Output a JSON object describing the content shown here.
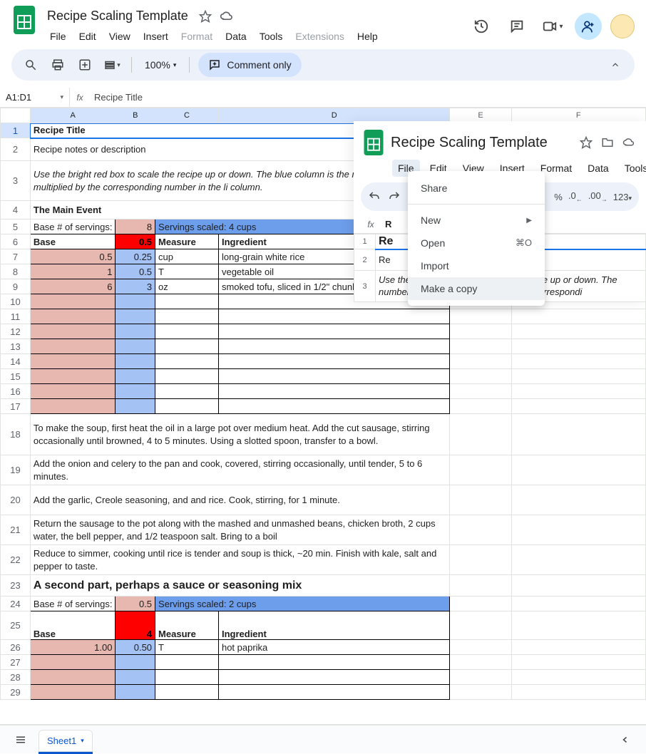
{
  "header": {
    "title": "Recipe Scaling Template",
    "menus": [
      "File",
      "Edit",
      "View",
      "Insert",
      "Format",
      "Data",
      "Tools",
      "Extensions",
      "Help"
    ],
    "disabled_menus": [
      "Format",
      "Extensions"
    ]
  },
  "toolbar": {
    "zoom": "100%",
    "mode_label": "Comment only"
  },
  "fx": {
    "namebox": "A1:D1",
    "formula": "Recipe Title"
  },
  "columns": [
    "A",
    "B",
    "C",
    "D",
    "E",
    "F"
  ],
  "rows": {
    "1": {
      "A": "Recipe Title"
    },
    "2": {
      "A": "Recipe notes or description"
    },
    "3": {
      "A": "Use the bright red box to scale the recipe up or down. The blue column is the number in bright red multiplied by the corresponding number in the li column."
    },
    "4": {
      "A": "The Main Event"
    },
    "5": {
      "A": "Base # of servings:",
      "B": "8",
      "C": "Servings scaled: 4 cups"
    },
    "6": {
      "A": "Base",
      "B": "0.5",
      "C": "Measure",
      "D": "Ingredient"
    },
    "7": {
      "A": "0.5",
      "B": "0.25",
      "C": "cup",
      "D": "long-grain white rice"
    },
    "8": {
      "A": "1",
      "B": "0.5",
      "C": "T",
      "D": "vegetable oil"
    },
    "9": {
      "A": "6",
      "B": "3",
      "C": "oz",
      "D": "smoked tofu, sliced in 1/2\" chunks"
    },
    "18": {
      "A": "To make the soup, first heat the oil in a large pot over medium heat. Add the cut sausage, stirring occasionally until browned, 4 to 5 minutes. Using a slotted spoon, transfer to a bowl."
    },
    "19": {
      "A": "Add the onion and celery to the pan and cook, covered, stirring occasionally, until tender, 5 to 6 minutes."
    },
    "20": {
      "A": "Add the garlic, Creole seasoning, and and rice. Cook, stirring, for 1 minute."
    },
    "21": {
      "A": "Return the sausage to the pot along with the mashed and unmashed beans, chicken broth, 2 cups water, the bell pepper, and 1/2 teaspoon salt. Bring to a boil"
    },
    "22": {
      "A": "Reduce to simmer, cooking until rice is tender and soup is thick, ~20 min. Finish with kale, salt and pepper to taste."
    },
    "23": {
      "A": "A second part, perhaps a sauce or seasoning mix"
    },
    "24": {
      "A": "Base # of servings:",
      "B": "0.5",
      "C": "Servings scaled: 2 cups"
    },
    "25": {
      "A": "Base",
      "B": "4",
      "C": "Measure",
      "D": "Ingredient"
    },
    "26": {
      "A": "1.00",
      "B": "0.50",
      "C": "T",
      "D": "hot paprika"
    }
  },
  "sheet_tab": "Sheet1",
  "overlay": {
    "title": "Recipe Scaling Template",
    "menus": [
      "File",
      "Edit",
      "View",
      "Insert",
      "Format",
      "Data",
      "Tools"
    ],
    "toolbar": {
      "pct": "%",
      "d0": ".0",
      "d00": ".00",
      "num": "123"
    },
    "fx": {
      "label": "R"
    },
    "rows": {
      "1": "Re",
      "2": "Re",
      "3": "Use the bright red box to scale the recipe up or down. The number in bright red multiplied by the correspondi"
    }
  },
  "dropdown": {
    "share": "Share",
    "new": "New",
    "open": "Open",
    "open_shortcut": "⌘O",
    "import": "Import",
    "make_copy": "Make a copy"
  }
}
